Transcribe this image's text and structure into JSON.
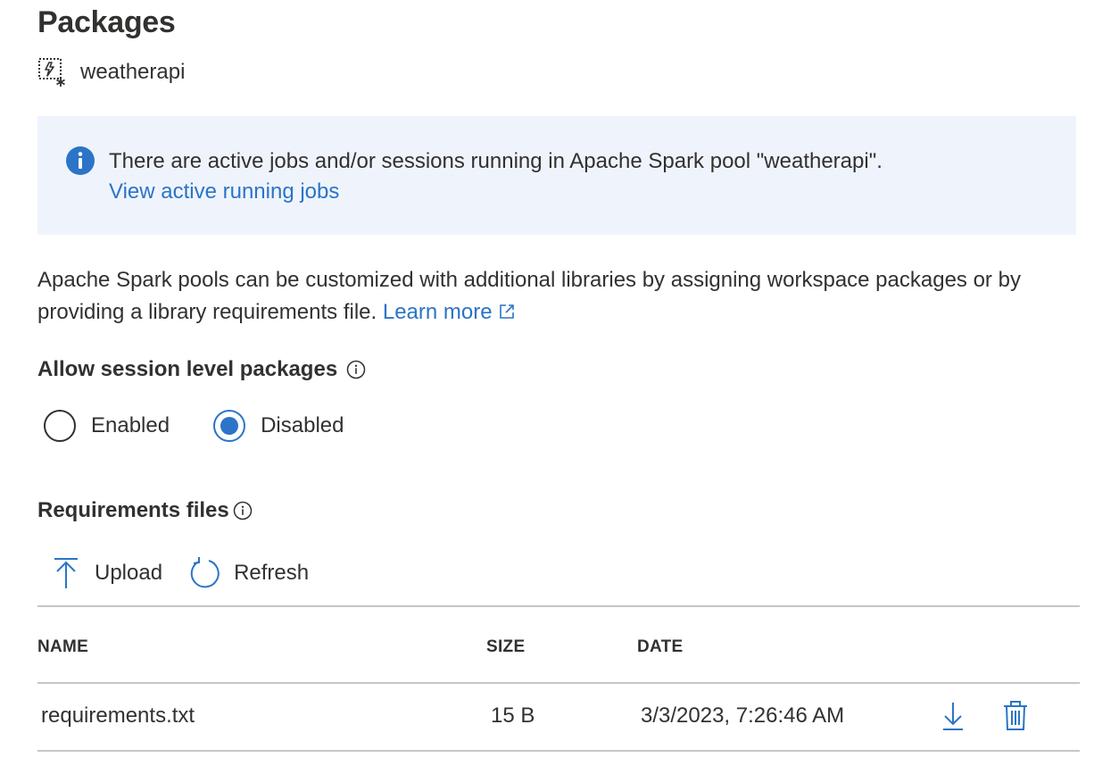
{
  "page": {
    "title": "Packages"
  },
  "pool": {
    "name": "weatherapi",
    "icon": "spark-pool-icon"
  },
  "info_bar": {
    "message": "There are active jobs and/or sessions running in Apache Spark pool \"weatherapi\".",
    "link_label": "View active running jobs",
    "icon": "info-icon",
    "accent_color": "#2b74c7",
    "background_color": "#eff4fc"
  },
  "description": {
    "text": "Apache Spark pools can be customized with additional libraries by assigning workspace packages or by providing a library requirements file.",
    "link_label": "Learn more"
  },
  "session_packages": {
    "label": "Allow session level packages",
    "options": [
      {
        "label": "Enabled",
        "selected": false
      },
      {
        "label": "Disabled",
        "selected": true
      }
    ]
  },
  "requirements": {
    "label": "Requirements files",
    "toolbar": {
      "upload_label": "Upload",
      "refresh_label": "Refresh"
    },
    "columns": {
      "name": "NAME",
      "size": "SIZE",
      "date": "DATE"
    },
    "rows": [
      {
        "name": "requirements.txt",
        "size": "15 B",
        "date": "3/3/2023, 7:26:46 AM"
      }
    ]
  }
}
